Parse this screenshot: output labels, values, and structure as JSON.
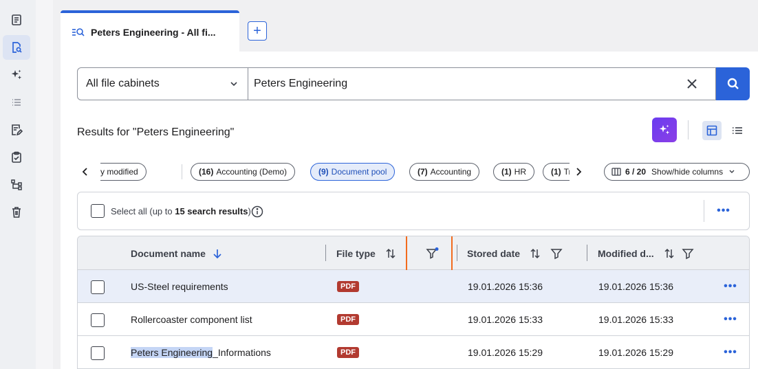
{
  "sidebar": {
    "items": [
      {
        "icon": "document-list-icon"
      },
      {
        "icon": "document-search-icon",
        "active": true
      },
      {
        "icon": "sparkles-icon"
      },
      {
        "icon": "list-icon"
      },
      {
        "icon": "document-edit-icon"
      },
      {
        "icon": "clipboard-check-icon"
      },
      {
        "icon": "workflow-icon"
      },
      {
        "icon": "trash-icon"
      }
    ]
  },
  "tabs": {
    "active_label": "Peters Engineering - All fi...",
    "add_label": "+"
  },
  "search": {
    "cabinet": "All file cabinets",
    "query": "Peters Engineering"
  },
  "results": {
    "title": "Results for \"Peters Engineering\""
  },
  "chips": {
    "items": [
      {
        "count": "",
        "label": "y modified"
      },
      {
        "count": "(16)",
        "label": "Accounting (Demo)"
      },
      {
        "count": "(9)",
        "label": "Document pool",
        "active": true
      },
      {
        "count": "(7)",
        "label": "Accounting"
      },
      {
        "count": "(1)",
        "label": "HR"
      },
      {
        "count": "(1)",
        "label": "Trave"
      }
    ],
    "columns_count": "6 / 20",
    "columns_label": "Show/hide columns"
  },
  "select_bar": {
    "prefix": "Select all (up to ",
    "bold": "15 search results",
    "suffix": ")"
  },
  "table": {
    "columns": [
      "Document name",
      "File type",
      "Stored date",
      "Modified d..."
    ],
    "rows": [
      {
        "name": "US-Steel requirements",
        "name_highlight": "",
        "type": "PDF",
        "stored": "19.01.2026 15:36",
        "modified": "19.01.2026 15:36"
      },
      {
        "name": "Rollercoaster component list",
        "name_highlight": "",
        "type": "PDF",
        "stored": "19.01.2026 15:33",
        "modified": "19.01.2026 15:33"
      },
      {
        "name": "_Informations",
        "name_highlight": "Peters Engineering",
        "type": "PDF",
        "stored": "19.01.2026 15:29",
        "modified": "19.01.2026 15:29"
      }
    ]
  },
  "colors": {
    "accent": "#2b63d9",
    "highlight_box": "#f26b1d",
    "pdf_badge": "#b23a30",
    "ai_button": "#7b3ff0"
  }
}
